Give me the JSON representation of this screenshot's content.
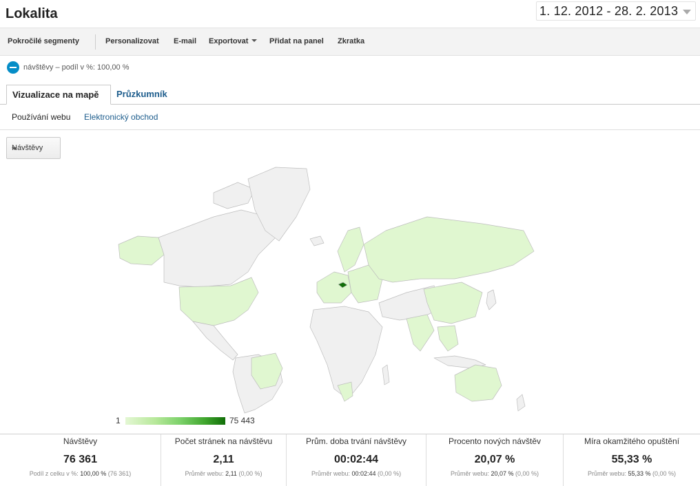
{
  "header": {
    "title": "Lokalita",
    "date_range": "1. 12. 2012 - 28. 2. 2013"
  },
  "toolbar": {
    "items": [
      {
        "label": "Pokročilé segmenty"
      },
      {
        "label": "Personalizovat"
      },
      {
        "label": "E-mail"
      },
      {
        "label": "Exportovat"
      },
      {
        "label": "Přidat na panel"
      },
      {
        "label": "Zkratka"
      }
    ]
  },
  "segment": {
    "label": "návštěvy – podíl v %: 100,00 %",
    "color": "#058dc7"
  },
  "tabs": [
    {
      "label": "Vizualizace na mapě",
      "active": true
    },
    {
      "label": "Průzkumník",
      "active": false
    }
  ],
  "subtabs": [
    {
      "label": "Používání webu",
      "active": true
    },
    {
      "label": "Elektronický obchod",
      "active": false
    }
  ],
  "metric_select": {
    "value": "Návštěvy"
  },
  "map": {
    "legend_min": "1",
    "legend_max": "75 443",
    "colors": {
      "none": "#f0f0f0",
      "low": "#e0f7d0",
      "high": "#116e08"
    }
  },
  "scorecards": [
    {
      "title": "Návštěvy",
      "value": "76 361",
      "sub_label": "Podíl z celku v %:",
      "sub_value": "100,00 %",
      "sub_extra": "(76 361)"
    },
    {
      "title": "Počet stránek na návštěvu",
      "value": "2,11",
      "sub_label": "Průměr webu:",
      "sub_value": "2,11",
      "sub_extra": "(0,00 %)"
    },
    {
      "title": "Prům. doba trvání návštěvy",
      "value": "00:02:44",
      "sub_label": "Průměr webu:",
      "sub_value": "00:02:44",
      "sub_extra": "(0,00 %)"
    },
    {
      "title": "Procento nových návštěv",
      "value": "20,07 %",
      "sub_label": "Průměr webu:",
      "sub_value": "20,07 %",
      "sub_extra": "(0,00 %)"
    },
    {
      "title": "Míra okamžitého opuštění",
      "value": "55,33 %",
      "sub_label": "Průměr webu:",
      "sub_value": "55,33 %",
      "sub_extra": "(0,00 %)"
    }
  ]
}
